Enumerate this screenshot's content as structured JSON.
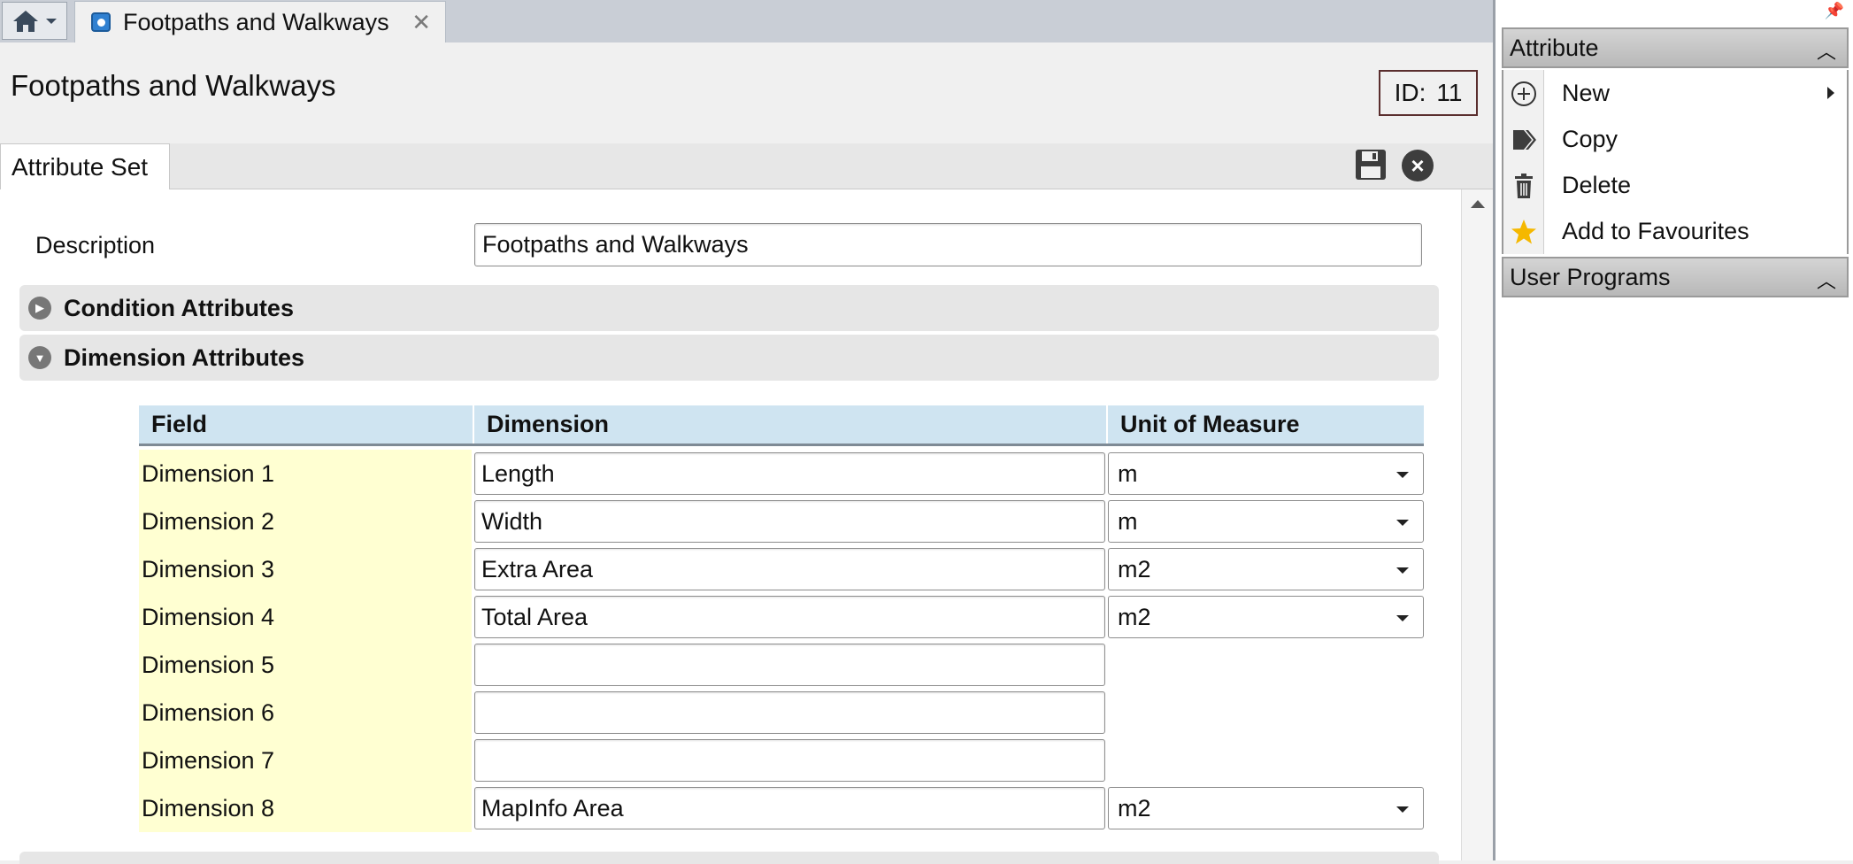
{
  "tabs": {
    "home_icon": "home-icon",
    "document_tab_label": "Footpaths and Walkways",
    "close_glyph": "✕"
  },
  "header": {
    "title": "Footpaths and Walkways",
    "id_label": "ID:",
    "id_value": "11"
  },
  "content_tabs": {
    "active_tab": "Attribute Set"
  },
  "form": {
    "description_label": "Description",
    "description_value": "Footpaths and Walkways",
    "condition_section_label": "Condition Attributes",
    "dimension_section_label": "Dimension Attributes"
  },
  "dimension_table": {
    "columns": [
      "Field",
      "Dimension",
      "Unit of Measure"
    ],
    "rows": [
      {
        "field": "Dimension 1",
        "dimension": "Length",
        "unit": "m"
      },
      {
        "field": "Dimension 2",
        "dimension": "Width",
        "unit": "m"
      },
      {
        "field": "Dimension 3",
        "dimension": "Extra Area",
        "unit": "m2"
      },
      {
        "field": "Dimension 4",
        "dimension": "Total Area",
        "unit": "m2"
      },
      {
        "field": "Dimension 5",
        "dimension": "",
        "unit": null
      },
      {
        "field": "Dimension 6",
        "dimension": "",
        "unit": null
      },
      {
        "field": "Dimension 7",
        "dimension": "",
        "unit": null
      },
      {
        "field": "Dimension 8",
        "dimension": "MapInfo Area",
        "unit": "m2"
      }
    ]
  },
  "side_panel": {
    "attribute_header": "Attribute",
    "menu": [
      {
        "label": "New",
        "icon": "plus-circle-icon",
        "has_submenu": true
      },
      {
        "label": "Copy",
        "icon": "copy-icon",
        "has_submenu": false
      },
      {
        "label": "Delete",
        "icon": "trash-icon",
        "has_submenu": false
      },
      {
        "label": "Add to Favourites",
        "icon": "star-icon",
        "has_submenu": false
      }
    ],
    "user_programs_header": "User Programs"
  },
  "colors": {
    "field_cell_bg": "#ffffd2",
    "table_header_bg": "#cfe4f1",
    "star": "#f5b800"
  }
}
